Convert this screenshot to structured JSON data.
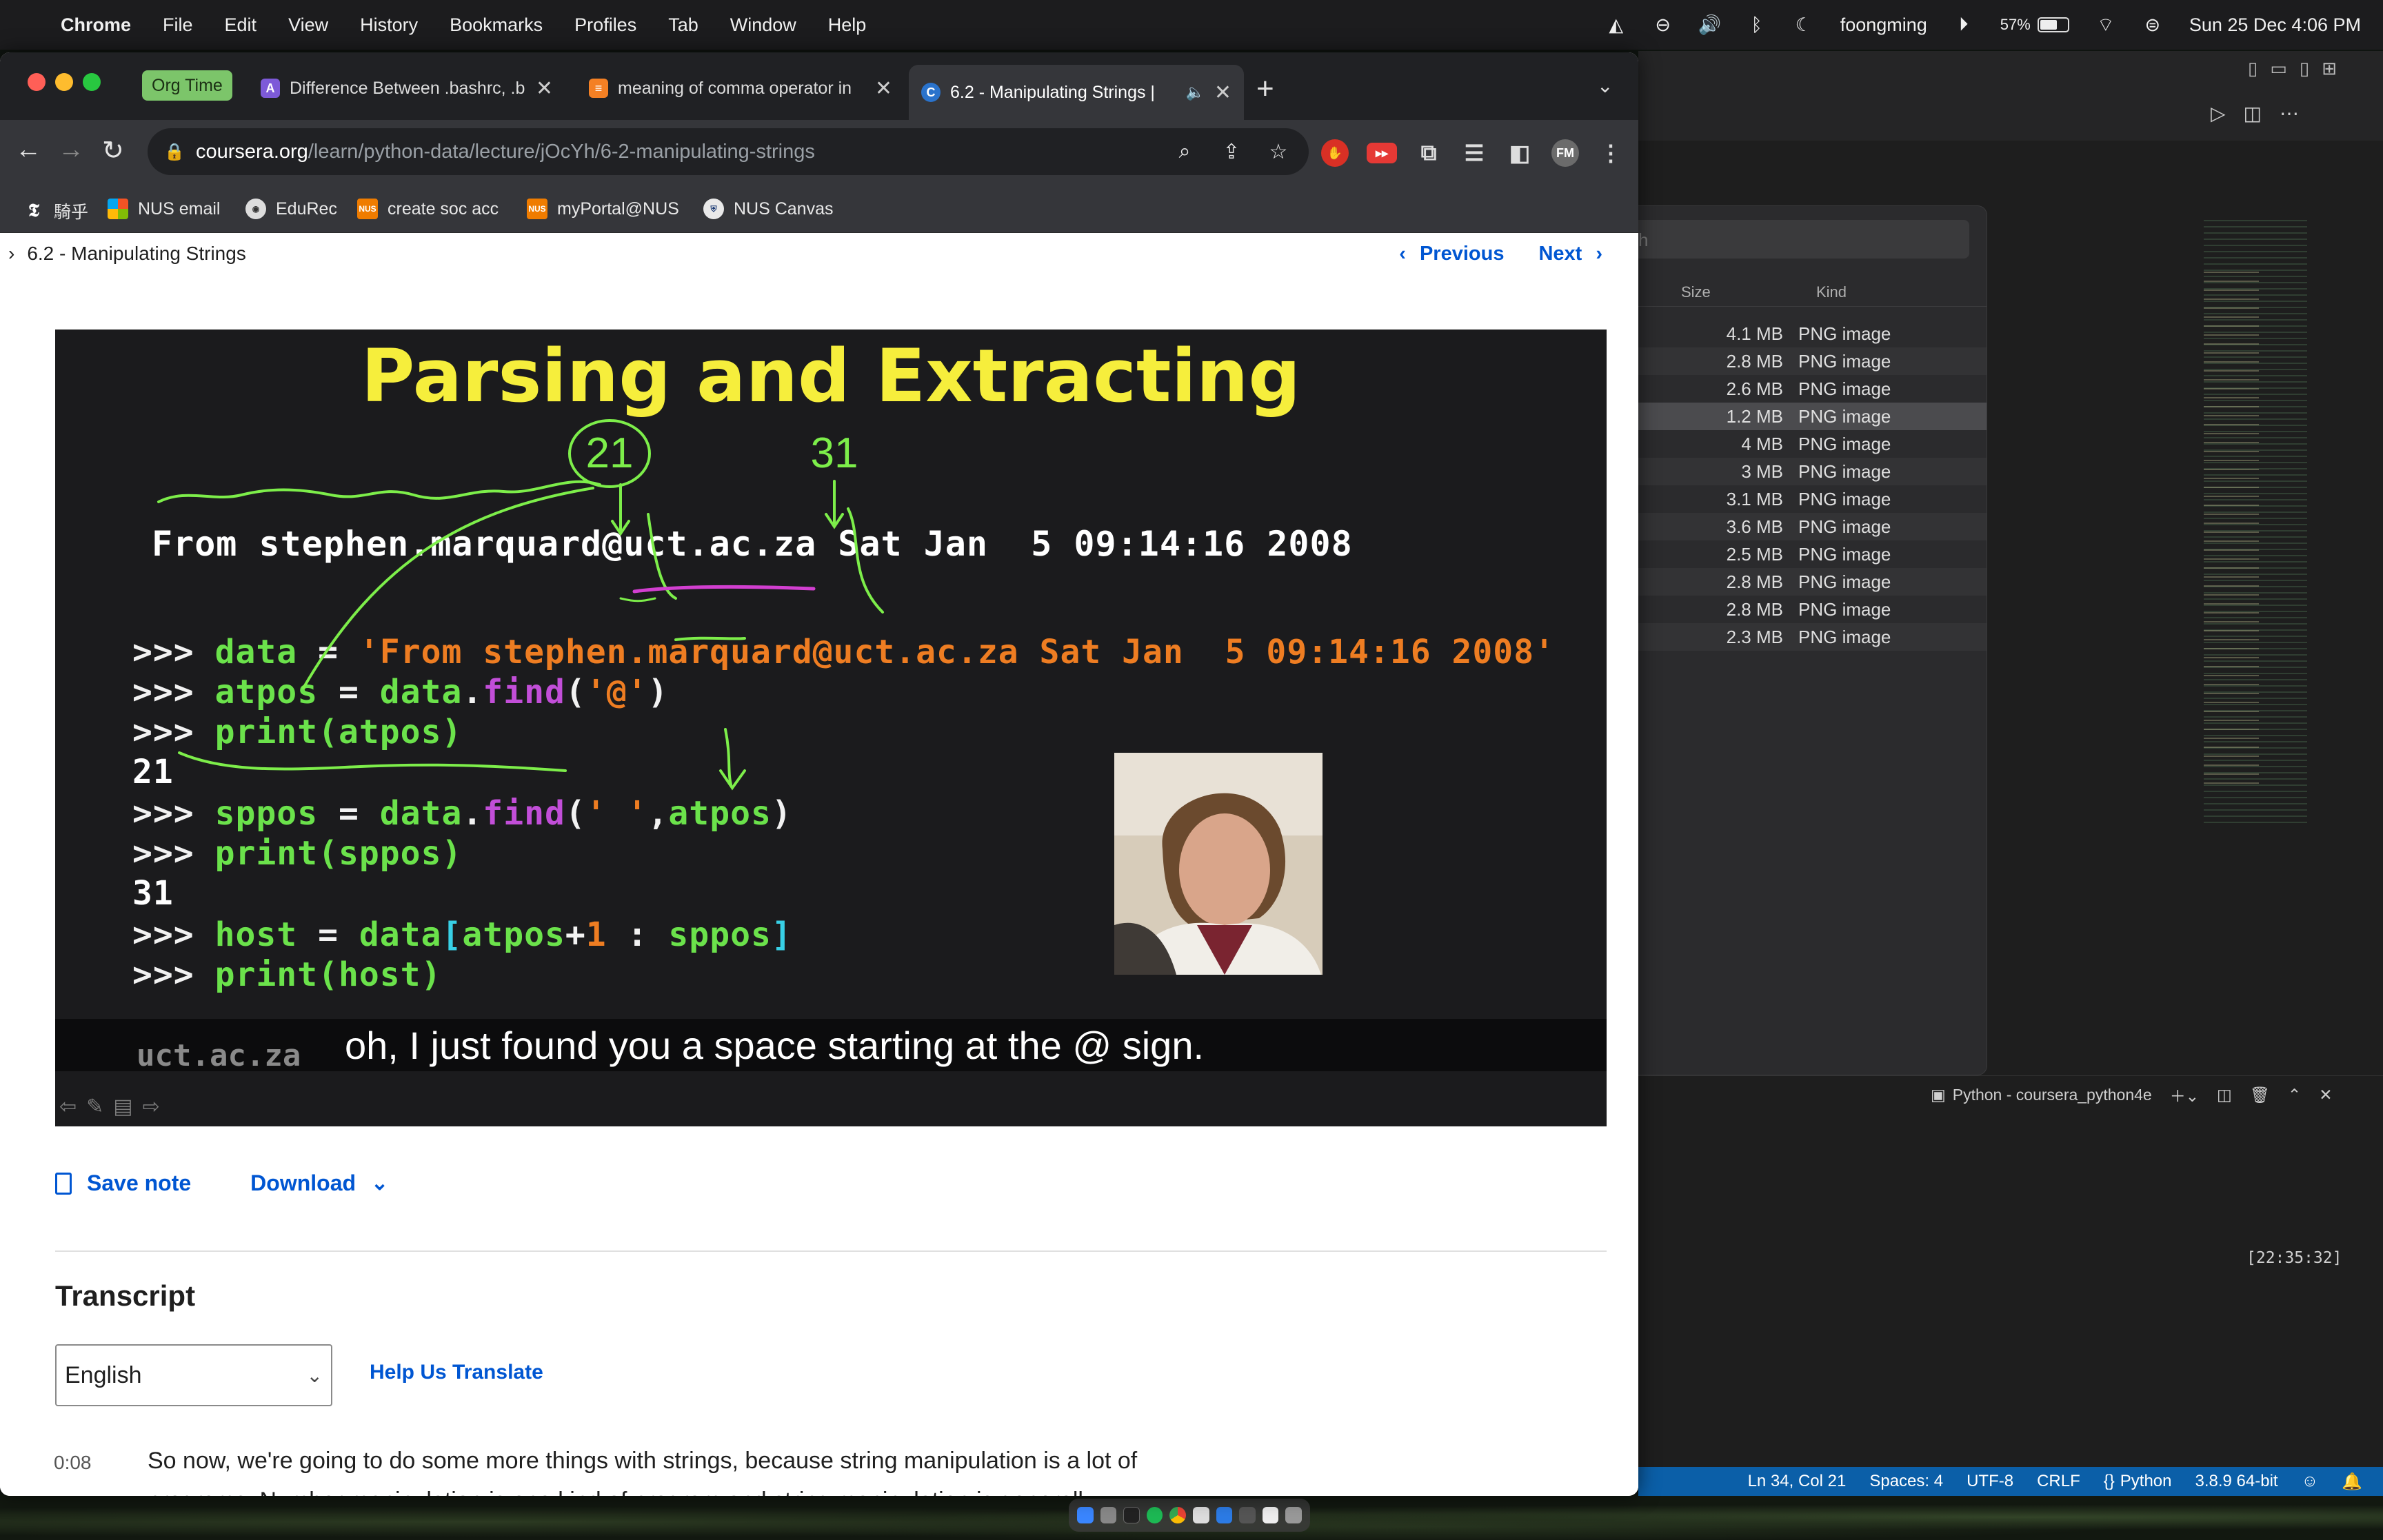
{
  "menubar": {
    "app": "Chrome",
    "items": [
      "File",
      "Edit",
      "View",
      "History",
      "Bookmarks",
      "Profiles",
      "Tab",
      "Window",
      "Help"
    ],
    "user": "foongming",
    "battery": "57%",
    "datetime": "Sun 25 Dec  4:06 PM"
  },
  "chrome": {
    "org_time": "Org Time",
    "tabs": [
      {
        "title": "Difference Between .bashrc, .b",
        "favicon": "A"
      },
      {
        "title": "meaning of comma operator in",
        "favicon": "≡"
      },
      {
        "title": "6.2 - Manipulating Strings |",
        "favicon": "C",
        "active": true
      }
    ],
    "url_host": "coursera.org",
    "url_path": "/learn/python-data/lecture/jOcYh/6-2-manipulating-strings",
    "profile_initials": "FM",
    "bookmarks": [
      {
        "label": "騎乎",
        "icon": "nyt-icon"
      },
      {
        "label": "NUS email",
        "icon": "microsoft-icon"
      },
      {
        "label": "EduRec",
        "icon": "edurec-icon"
      },
      {
        "label": "create soc acc",
        "icon": "nus-icon"
      },
      {
        "label": "myPortal@NUS",
        "icon": "nus-icon"
      },
      {
        "label": "NUS Canvas",
        "icon": "canvas-icon"
      }
    ]
  },
  "page": {
    "breadcrumb": "6.2 - Manipulating Strings",
    "previous": "Previous",
    "next": "Next",
    "slide": {
      "title": "Parsing and Extracting",
      "from_line": "From stephen.marquard@uct.ac.za Sat Jan  5 09:14:16 2008",
      "annotation_21": "21",
      "annotation_31": "31",
      "caption": "oh, I just found you a space starting at the @ sign.",
      "under_caption": "uct.ac.za",
      "out_21": "21",
      "out_31": "31"
    },
    "save_note": "Save note",
    "download": "Download",
    "transcript_heading": "Transcript",
    "language": "English",
    "help_translate": "Help Us Translate",
    "transcript_time": "0:08",
    "transcript_text": "So now, we're going to do some more things with strings, because string manipulation is a lot of programs. Number manipulation is one kind of program and string manipulation is generally another thing that we do in programs. So let's just ... the +, we've been doing that, where it sort"
  },
  "finder": {
    "search_placeholder": "h",
    "col_size": "Size",
    "col_kind": "Kind",
    "rows": [
      {
        "size": "4.1 MB",
        "kind": "PNG image"
      },
      {
        "size": "2.8 MB",
        "kind": "PNG image"
      },
      {
        "size": "2.6 MB",
        "kind": "PNG image"
      },
      {
        "size": "1.2 MB",
        "kind": "PNG image"
      },
      {
        "size": "4 MB",
        "kind": "PNG image"
      },
      {
        "size": "3 MB",
        "kind": "PNG image"
      },
      {
        "size": "3.1 MB",
        "kind": "PNG image"
      },
      {
        "size": "3.6 MB",
        "kind": "PNG image"
      },
      {
        "size": "2.5 MB",
        "kind": "PNG image"
      },
      {
        "size": "2.8 MB",
        "kind": "PNG image"
      },
      {
        "size": "2.8 MB",
        "kind": "PNG image"
      },
      {
        "size": "2.3 MB",
        "kind": "PNG image"
      }
    ]
  },
  "vscode": {
    "terminal_title": "Python - coursera_python4e",
    "terminal_time": "[22:35:32]",
    "status": {
      "position": "Ln 34, Col 21",
      "spaces": "Spaces: 4",
      "encoding": "UTF-8",
      "eol": "CRLF",
      "language": "Python",
      "interpreter": "3.8.9 64-bit"
    }
  },
  "colors": {
    "coursera_blue": "#0056d2",
    "slide_title": "#f6ee3c",
    "vscode_status": "#0b5fa8"
  }
}
